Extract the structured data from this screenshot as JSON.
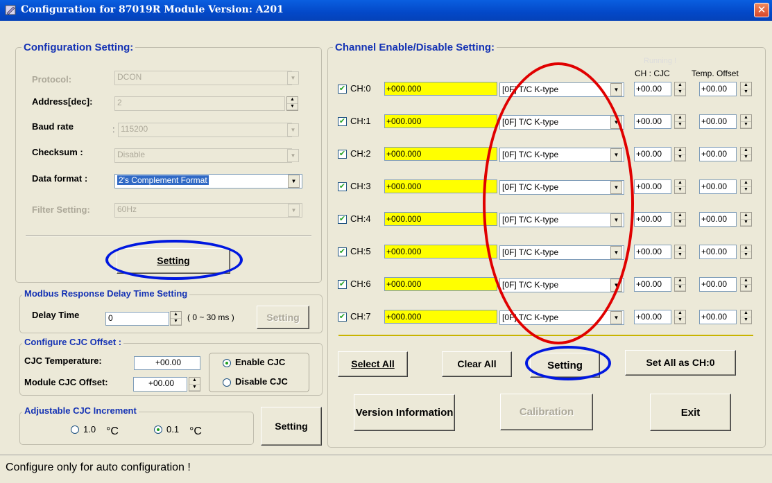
{
  "window": {
    "title": "Configuration for 87019R Module Version: A201",
    "close_glyph": "✕"
  },
  "config": {
    "legend": "Configuration Setting:",
    "protocol_label": "Protocol:",
    "protocol_value": "DCON",
    "address_label": "Address[dec]:",
    "address_value": "2",
    "baud_label": "Baud rate",
    "baud_colon": ":",
    "baud_value": "115200",
    "checksum_label": "Checksum  :",
    "checksum_value": "Disable",
    "format_label": "Data format :",
    "format_value": "2's Complement Format",
    "filter_label": "Filter Setting:",
    "filter_value": "60Hz",
    "setting_button": "Setting"
  },
  "modbus": {
    "legend": "Modbus Response Delay Time Setting",
    "delay_label": "Delay Time",
    "delay_value": "0",
    "range_text": "( 0 ~ 30 ms )",
    "setting_button": "Setting"
  },
  "cjc": {
    "legend": "Configure CJC Offset :",
    "temp_label": "CJC Temperature:",
    "temp_value": "+00.00",
    "offset_label": "Module CJC Offset:",
    "offset_value": "+00.00",
    "enable_label": "Enable CJC",
    "disable_label": "Disable CJC",
    "selected": "enable"
  },
  "increment": {
    "legend": "Adjustable CJC Increment",
    "opt1": "1.0",
    "opt2": "0.1",
    "unit": "°C",
    "selected": "0.1",
    "setting_button": "Setting"
  },
  "channels": {
    "legend": "Channel Enable/Disable Setting:",
    "running_text": "Running !",
    "col_cjc": "CH : CJC",
    "col_offset": "Temp. Offset",
    "rows": [
      {
        "label": "CH:0",
        "checked": true,
        "value": "+000.000",
        "type": "[0F] T/C K-type",
        "cjc": "+00.00",
        "offset": "+00.00"
      },
      {
        "label": "CH:1",
        "checked": true,
        "value": "+000.000",
        "type": "[0F] T/C K-type",
        "cjc": "+00.00",
        "offset": "+00.00"
      },
      {
        "label": "CH:2",
        "checked": true,
        "value": "+000.000",
        "type": "[0F] T/C K-type",
        "cjc": "+00.00",
        "offset": "+00.00"
      },
      {
        "label": "CH:3",
        "checked": true,
        "value": "+000.000",
        "type": "[0F] T/C K-type",
        "cjc": "+00.00",
        "offset": "+00.00"
      },
      {
        "label": "CH:4",
        "checked": true,
        "value": "+000.000",
        "type": "[0F] T/C K-type",
        "cjc": "+00.00",
        "offset": "+00.00"
      },
      {
        "label": "CH:5",
        "checked": true,
        "value": "+000.000",
        "type": "[0F] T/C K-type",
        "cjc": "+00.00",
        "offset": "+00.00"
      },
      {
        "label": "CH:6",
        "checked": true,
        "value": "+000.000",
        "type": "[0F] T/C K-type",
        "cjc": "+00.00",
        "offset": "+00.00"
      },
      {
        "label": "CH:7",
        "checked": true,
        "value": "+000.000",
        "type": "[0F] T/C K-type",
        "cjc": "+00.00",
        "offset": "+00.00"
      }
    ],
    "select_all": "Select All",
    "clear_all": "Clear All",
    "setting": "Setting",
    "set_all": "Set All as CH:0"
  },
  "bottom": {
    "version": "Version Information",
    "calibration": "Calibration",
    "exit": "Exit"
  },
  "status": {
    "text": "Configure only for auto configuration !"
  },
  "colors": {
    "annotation_red": "#e00000",
    "annotation_blue": "#0018e0",
    "value_bg": "#ffff00"
  }
}
